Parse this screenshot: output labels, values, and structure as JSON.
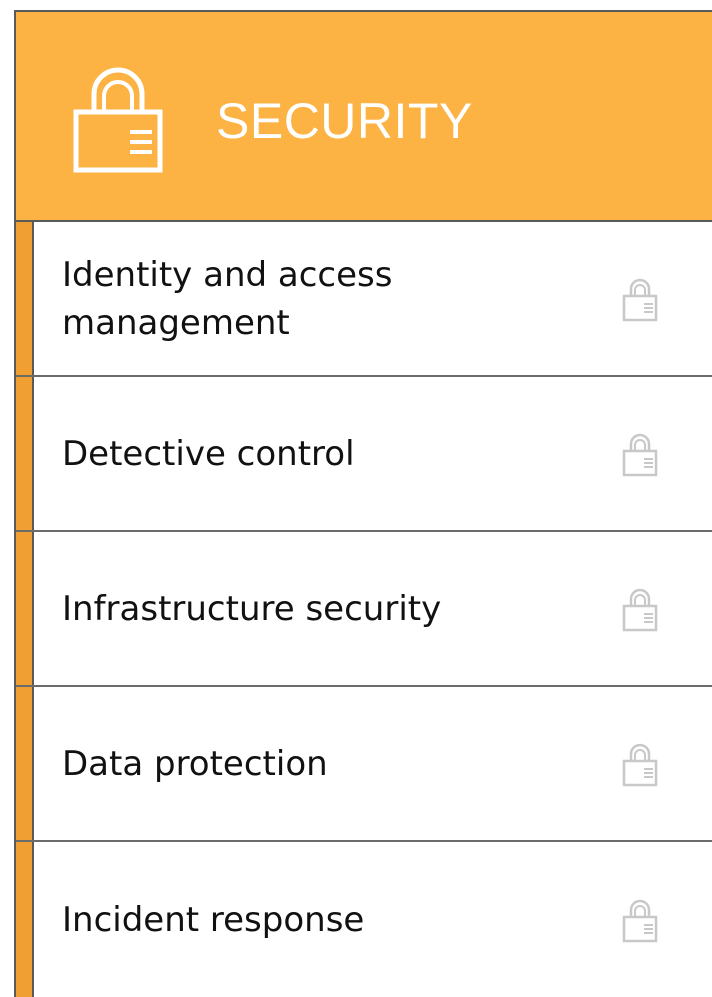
{
  "header": {
    "title": "SECURITY",
    "icon": "lock-icon",
    "background_color": "#fdb244",
    "text_color": "#ffffff"
  },
  "items": [
    {
      "label": "Identity and access management",
      "icon": "lock-icon"
    },
    {
      "label": "Detective control",
      "icon": "lock-icon"
    },
    {
      "label": "Infrastructure security",
      "icon": "lock-icon"
    },
    {
      "label": "Data protection",
      "icon": "lock-icon"
    },
    {
      "label": "Incident response",
      "icon": "lock-icon"
    }
  ],
  "colors": {
    "accent": "#f0a033",
    "border": "#5a5a5a",
    "item_lock": "#c8c8c8"
  }
}
